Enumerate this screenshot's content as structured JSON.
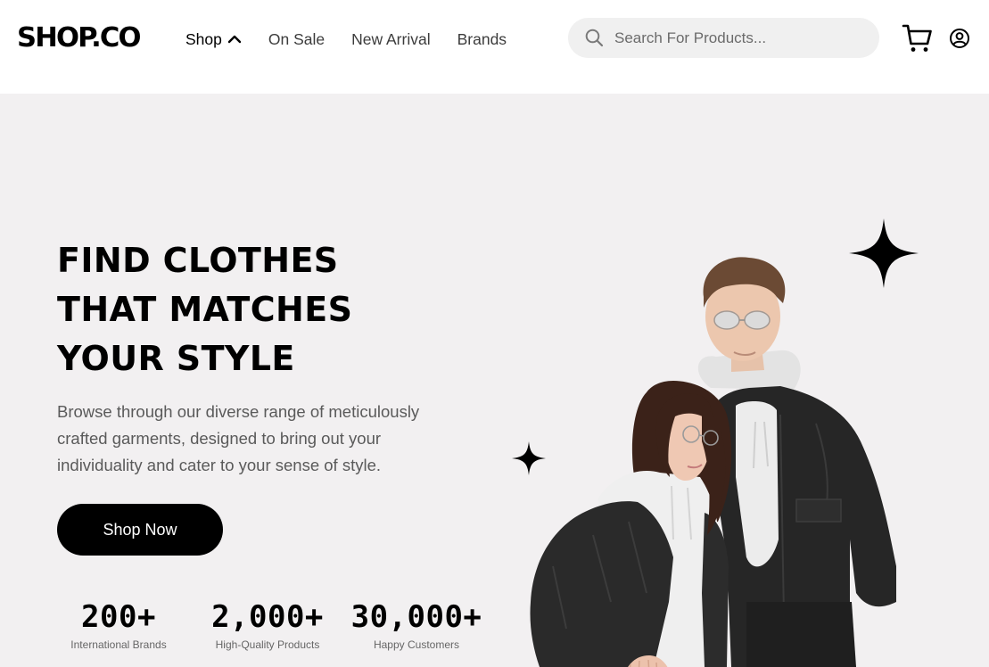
{
  "navbar": {
    "logo": "SHOP.CO",
    "links": [
      {
        "label": "Shop",
        "active": true
      },
      {
        "label": "On Sale"
      },
      {
        "label": "New Arrival"
      },
      {
        "label": "Brands"
      }
    ],
    "search_placeholder": "Search For Products..."
  },
  "icons": {
    "search": "search-icon",
    "cart": "cart-icon",
    "account": "account-icon",
    "shop_chevron": "chevron-up-icon",
    "sparkle": "sparkle-icon"
  },
  "hero": {
    "headline": [
      "FIND CLOTHES",
      "THAT MATCHES",
      "YOUR STYLE"
    ],
    "subtext": "Browse through our diverse range of meticulously crafted garments, designed to bring out your individuality and cater to your sense of style.",
    "cta_label": "Shop Now",
    "stats": [
      {
        "value": "200+",
        "label": "International Brands"
      },
      {
        "value": "2,000+",
        "label": "High-Quality Products"
      },
      {
        "value": "30,000+",
        "label": "Happy Customers"
      }
    ]
  },
  "colors": {
    "hero_background": "#f2f0f1",
    "primary": "#000000",
    "search_background": "#f0f0f0"
  }
}
